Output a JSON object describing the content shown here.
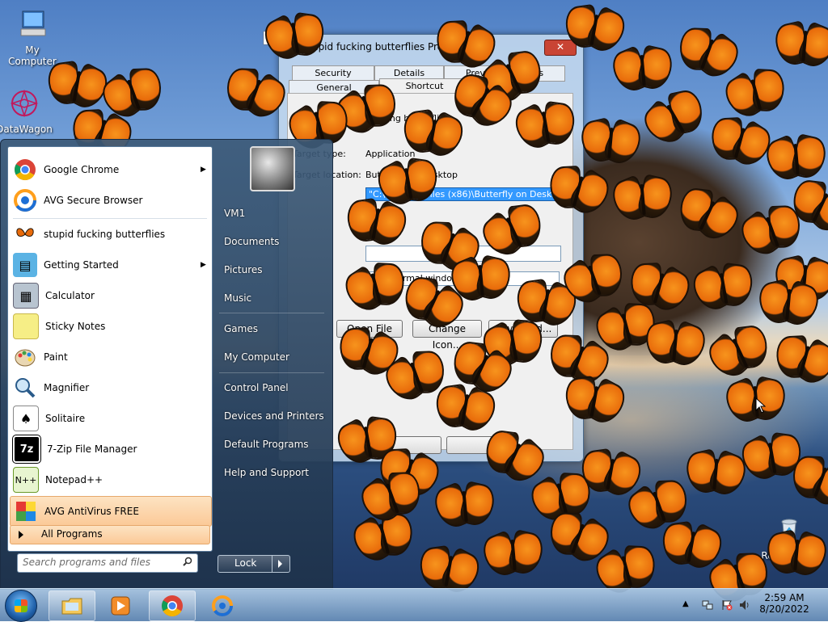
{
  "desktop": {
    "icons": [
      {
        "label": "My Computer"
      },
      {
        "label": "DataWagon"
      },
      {
        "label": "Recycle Bin"
      }
    ]
  },
  "dialog": {
    "title": "stupid fucking butterflies Properties",
    "tabs_back": [
      "Security",
      "Details",
      "Previous Versions"
    ],
    "tabs_front": [
      "General",
      "Shortcut"
    ],
    "name_label": "stupid fucking butterflies",
    "target_type_label": "Target type:",
    "target_type_value": "Application",
    "target_location_label": "Target location:",
    "target_location_value": "Butterfly on Desktop",
    "target_value": "\"C:\\Program Files (x86)\\Butterfly on Desktop\\ButterflyOnDesktop.exe\"",
    "run_value": "Normal window",
    "change_icon_label": "Change Icon...",
    "open_location_label": "Open File Location",
    "advanced_label": "Advanced..."
  },
  "start_menu": {
    "pinned": [
      {
        "label": "Google Chrome",
        "arrow": true
      },
      {
        "label": "AVG Secure Browser",
        "arrow": false
      }
    ],
    "recent": [
      {
        "label": "stupid fucking butterflies",
        "arrow": false
      },
      {
        "label": "Getting Started",
        "arrow": true
      },
      {
        "label": "Calculator",
        "arrow": false
      },
      {
        "label": "Sticky Notes",
        "arrow": false
      },
      {
        "label": "Paint",
        "arrow": false
      },
      {
        "label": "Magnifier",
        "arrow": false
      },
      {
        "label": "Solitaire",
        "arrow": false
      },
      {
        "label": "7-Zip File Manager",
        "arrow": false
      },
      {
        "label": "Notepad++",
        "arrow": false
      },
      {
        "label": "AVG AntiVirus FREE",
        "arrow": false
      }
    ],
    "all_programs": "All Programs",
    "search_placeholder": "Search programs and files",
    "right_items": [
      "VM1",
      "Documents",
      "Pictures",
      "Music",
      "Games",
      "My Computer",
      "Control Panel",
      "Devices and Printers",
      "Default Programs",
      "Help and Support"
    ],
    "lock_label": "Lock"
  },
  "taskbar": {
    "time": "2:59 AM",
    "date": "8/20/2022"
  },
  "colors": {
    "butterfly": "#e86a0a",
    "highlight": "#fbc997",
    "selection": "#3399ff"
  }
}
